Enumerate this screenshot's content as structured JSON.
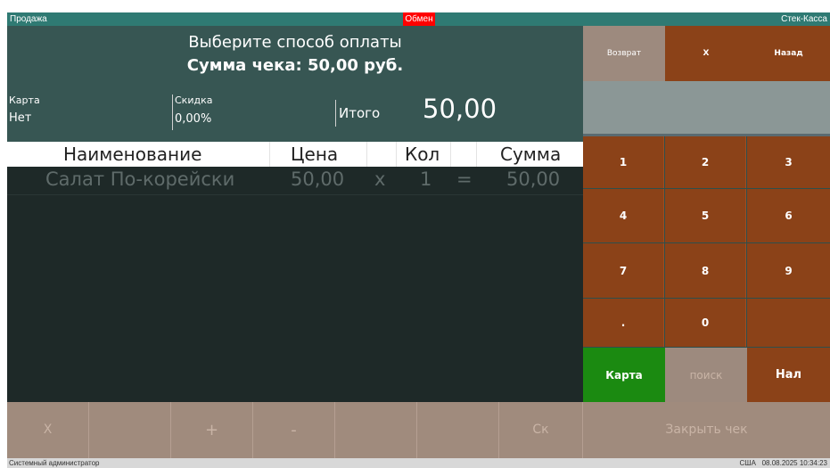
{
  "titlebar": {
    "left": "Продажа",
    "center": "Обмен",
    "right": "Стек-Касса"
  },
  "header": {
    "line1": "Выберите способ оплаты",
    "line2": "Сумма чека: 50,00 руб."
  },
  "summary": {
    "card_label": "Карта",
    "card_value": "Нет",
    "discount_label": "Скидка",
    "discount_value": "0,00%",
    "total_label": "Итого",
    "total_value": "50,00"
  },
  "table": {
    "headers": {
      "name": "Наименование",
      "price": "Цена",
      "qty": "Кол",
      "sum": "Сумма"
    },
    "rows": [
      {
        "name": "Салат По-корейски",
        "price": "50,00",
        "x": "x",
        "qty": "1",
        "eq": "=",
        "sum": "50,00"
      }
    ]
  },
  "bottom": {
    "b1": "X",
    "b2": "",
    "b3": "+",
    "b4": "-",
    "b5": "",
    "b6": "",
    "b7": "Ск",
    "close": "Закрыть чек"
  },
  "keypad": {
    "return": "Возврат",
    "x": "X",
    "back": "Назад",
    "k1": "1",
    "k2": "2",
    "k3": "3",
    "k4": "4",
    "k5": "5",
    "k6": "6",
    "k7": "7",
    "k8": "8",
    "k9": "9",
    "kdot": ".",
    "k0": "0",
    "kempty": "",
    "card": "Карта",
    "search": "поиск",
    "cash": "Нал"
  },
  "status": {
    "user": "Системный администратор",
    "locale": "США",
    "datetime": "08.08.2025 10:34:23"
  },
  "colors": {
    "accent_brown": "#8b4218",
    "green": "#1b8a11",
    "title": "#2f7a73",
    "exchange": "#ff0000"
  }
}
